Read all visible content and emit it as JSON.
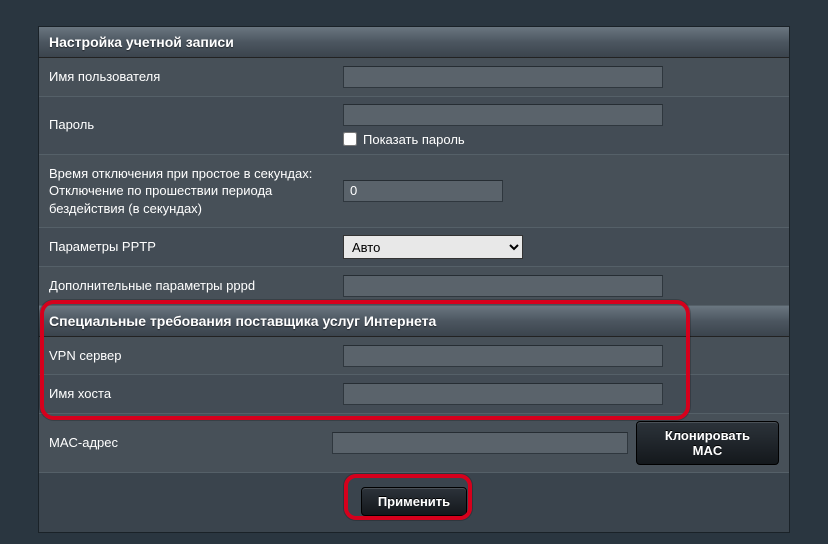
{
  "section1": {
    "title": "Настройка учетной записи",
    "rows": {
      "username_label": "Имя пользователя",
      "username_value": "",
      "password_label": "Пароль",
      "password_value": "",
      "show_password_label": "Показать пароль",
      "idle_label": "Время отключения при простое в секундах: Отключение по прошествии периода бездействия (в секундах)",
      "idle_value": "0",
      "pptp_label": "Параметры PPTP",
      "pptp_value": "Авто",
      "pppd_label": "Дополнительные параметры pppd",
      "pppd_value": ""
    }
  },
  "section2": {
    "title": "Специальные требования поставщика услуг Интернета",
    "rows": {
      "vpn_label": "VPN сервер",
      "vpn_value": "",
      "host_label": "Имя хоста",
      "host_value": "",
      "mac_label": "MAC-адрес",
      "mac_value": "",
      "clone_mac_label": "Клонировать MAC"
    }
  },
  "apply_label": "Применить"
}
